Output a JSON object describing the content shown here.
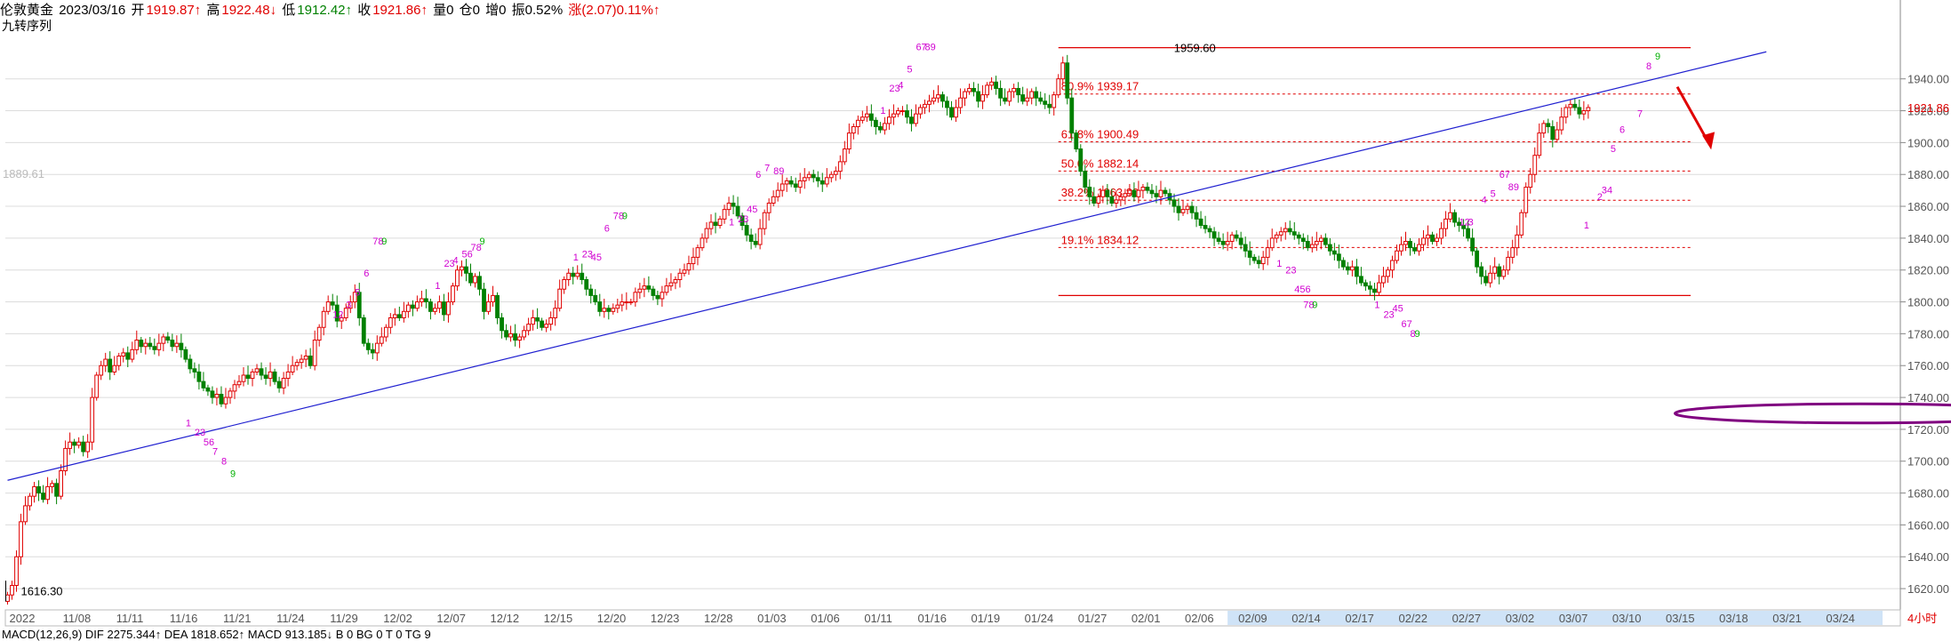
{
  "header": {
    "symbol": "伦敦黄金",
    "date": "2023/03/16",
    "open_label": "开",
    "open": "1919.87↑",
    "high_label": "高",
    "high": "1922.48↓",
    "low_label": "低",
    "low": "1912.42↑",
    "close_label": "收",
    "close": "1921.86↑",
    "vol": "量0",
    "oi": "仓0",
    "inc": "增0",
    "amp": "振0.52%",
    "chg": "涨(2.07)0.11%↑"
  },
  "indicator_name": "九转序列",
  "indicator_bar": "MACD(12,26,9)  DIF 2275.344↑  DEA 1818.652↑  MACD 913.185↓  B 0  BG 0  T 0  TG 9",
  "colors": {
    "up": "#e00000",
    "down": "#008000",
    "trend": "#2020d0",
    "fib": "#e00000",
    "ellipse": "#800080",
    "arrow": "#e00000",
    "td_low": "#d000d0",
    "td_9": "#00b000"
  },
  "chart_data": {
    "type": "candlestick",
    "ylim": [
      1610,
      1975
    ],
    "yticks": [
      1620,
      1640,
      1660,
      1680,
      1700,
      1720,
      1740,
      1760,
      1780,
      1800,
      1820,
      1840,
      1860,
      1880,
      1900,
      1920,
      1940
    ],
    "ytick_labels": [
      "1620.00",
      "1640.00",
      "1660.00",
      "1680.00",
      "1700.00",
      "1720.00",
      "1740.00",
      "1760.00",
      "1780.00",
      "1800.00",
      "1820.00",
      "1840.00",
      "1860.00",
      "1880.00",
      "1900.00",
      "1920.00",
      "1940.00"
    ],
    "x_labels": [
      "2022",
      "11/08",
      "11/11",
      "11/16",
      "11/21",
      "11/24",
      "11/29",
      "12/02",
      "12/07",
      "12/12",
      "12/15",
      "12/20",
      "12/23",
      "12/28",
      "01/03",
      "01/06",
      "01/11",
      "01/16",
      "01/19",
      "01/24",
      "01/27",
      "02/01",
      "02/06",
      "02/09",
      "02/14",
      "02/17",
      "02/22",
      "02/27",
      "03/02",
      "03/07",
      "03/10",
      "03/15",
      "03/18",
      "03/21",
      "03/24"
    ],
    "x_label_slot": [
      0,
      12,
      24,
      36,
      48,
      60,
      72,
      84,
      96,
      108,
      120,
      132,
      144,
      156,
      168,
      180,
      192,
      204,
      216,
      228,
      240,
      252,
      264,
      276,
      288,
      300,
      312,
      324,
      336,
      348,
      360,
      372,
      384,
      396,
      408
    ],
    "timeframe": "4小时",
    "last_price": "1921.86",
    "prev_high_label": "1889.61",
    "low_label": "1616.30",
    "high_label": "1959.60",
    "closes": [
      1616,
      1622,
      1640,
      1662,
      1672,
      1678,
      1684,
      1680,
      1676,
      1684,
      1686,
      1678,
      1694,
      1708,
      1712,
      1710,
      1712,
      1706,
      1712,
      1740,
      1754,
      1760,
      1764,
      1756,
      1760,
      1766,
      1768,
      1764,
      1770,
      1776,
      1772,
      1774,
      1772,
      1770,
      1774,
      1778,
      1776,
      1772,
      1774,
      1770,
      1764,
      1758,
      1756,
      1750,
      1746,
      1744,
      1740,
      1742,
      1736,
      1740,
      1744,
      1748,
      1750,
      1754,
      1752,
      1756,
      1758,
      1754,
      1752,
      1756,
      1750,
      1746,
      1752,
      1756,
      1760,
      1762,
      1764,
      1766,
      1760,
      1776,
      1784,
      1794,
      1800,
      1798,
      1788,
      1790,
      1796,
      1800,
      1806,
      1790,
      1774,
      1770,
      1768,
      1774,
      1778,
      1784,
      1790,
      1792,
      1790,
      1794,
      1798,
      1796,
      1800,
      1802,
      1800,
      1794,
      1796,
      1800,
      1792,
      1800,
      1810,
      1820,
      1822,
      1818,
      1812,
      1816,
      1808,
      1794,
      1800,
      1804,
      1790,
      1782,
      1778,
      1780,
      1776,
      1778,
      1782,
      1786,
      1790,
      1788,
      1784,
      1786,
      1790,
      1796,
      1808,
      1814,
      1818,
      1816,
      1818,
      1814,
      1808,
      1804,
      1800,
      1794,
      1796,
      1794,
      1796,
      1798,
      1800,
      1800,
      1800,
      1806,
      1808,
      1810,
      1808,
      1804,
      1802,
      1806,
      1810,
      1812,
      1814,
      1818,
      1820,
      1824,
      1828,
      1834,
      1840,
      1846,
      1850,
      1848,
      1852,
      1858,
      1862,
      1860,
      1854,
      1848,
      1842,
      1838,
      1836,
      1846,
      1856,
      1862,
      1866,
      1870,
      1874,
      1876,
      1874,
      1872,
      1876,
      1878,
      1880,
      1878,
      1876,
      1874,
      1878,
      1880,
      1882,
      1888,
      1896,
      1906,
      1910,
      1914,
      1916,
      1918,
      1914,
      1910,
      1908,
      1912,
      1916,
      1918,
      1920,
      1920,
      1916,
      1912,
      1918,
      1922,
      1924,
      1926,
      1928,
      1930,
      1926,
      1922,
      1916,
      1922,
      1928,
      1932,
      1934,
      1932,
      1926,
      1930,
      1936,
      1938,
      1934,
      1928,
      1926,
      1932,
      1934,
      1930,
      1926,
      1928,
      1932,
      1928,
      1926,
      1924,
      1922,
      1930,
      1940,
      1950,
      1928,
      1906,
      1896,
      1882,
      1872,
      1866,
      1862,
      1866,
      1870,
      1866,
      1862,
      1864,
      1866,
      1868,
      1870,
      1866,
      1870,
      1872,
      1870,
      1868,
      1866,
      1870,
      1868,
      1864,
      1860,
      1856,
      1858,
      1860,
      1856,
      1852,
      1848,
      1846,
      1844,
      1840,
      1838,
      1836,
      1838,
      1842,
      1840,
      1836,
      1832,
      1828,
      1826,
      1824,
      1828,
      1834,
      1840,
      1842,
      1844,
      1846,
      1844,
      1842,
      1840,
      1838,
      1834,
      1836,
      1838,
      1840,
      1836,
      1832,
      1830,
      1826,
      1822,
      1820,
      1822,
      1816,
      1812,
      1810,
      1808,
      1806,
      1812,
      1816,
      1820,
      1826,
      1832,
      1836,
      1838,
      1834,
      1832,
      1836,
      1840,
      1842,
      1838,
      1840,
      1846,
      1852,
      1856,
      1850,
      1848,
      1846,
      1840,
      1832,
      1822,
      1816,
      1812,
      1818,
      1822,
      1816,
      1820,
      1828,
      1834,
      1842,
      1856,
      1872,
      1880,
      1892,
      1906,
      1912,
      1910,
      1902,
      1908,
      1916,
      1922,
      1924,
      1922,
      1918,
      1920,
      1922
    ],
    "fib_levels": [
      {
        "label": "80.9%  1939.17",
        "value": 1930.5
      },
      {
        "label": "61.8%  1900.49",
        "value": 1900.49
      },
      {
        "label": "50.0%  1882.14",
        "value": 1882.14
      },
      {
        "label": "38.2%  1863.80",
        "value": 1863.8
      },
      {
        "label": "19.1%  1834.12",
        "value": 1834.12
      }
    ],
    "fib_top": 1959.6,
    "fib_bottom": 1804.0,
    "trendline": [
      [
        0,
        1688
      ],
      [
        395,
        1957
      ]
    ],
    "ellipses": [
      {
        "cx": 52,
        "cy": 1730,
        "rx": 26,
        "ry": 6
      },
      {
        "cx": 125,
        "cy": 1781,
        "rx": 35,
        "ry": 10
      },
      {
        "cx": 268,
        "cy": 1864,
        "rx": 26,
        "ry": 8
      },
      {
        "cx": 375,
        "cy": 1933,
        "rx": 25,
        "ry": 9
      }
    ],
    "td_labels": [
      {
        "slot": 40,
        "v": 1722,
        "t": "1"
      },
      {
        "slot": 42,
        "v": 1716,
        "t": "23"
      },
      {
        "slot": 44,
        "v": 1710,
        "t": "56"
      },
      {
        "slot": 46,
        "v": 1704,
        "t": "7"
      },
      {
        "slot": 48,
        "v": 1698,
        "t": "8"
      },
      {
        "slot": 50,
        "v": 1690,
        "t": "9"
      },
      {
        "slot": 73,
        "v": 1790,
        "t": "12"
      },
      {
        "slot": 76,
        "v": 1796,
        "t": "3"
      },
      {
        "slot": 78,
        "v": 1804,
        "t": "5"
      },
      {
        "slot": 80,
        "v": 1816,
        "t": "6"
      },
      {
        "slot": 82,
        "v": 1836,
        "t": "78"
      },
      {
        "slot": 84,
        "v": 1836,
        "t": "9"
      },
      {
        "slot": 96,
        "v": 1808,
        "t": "1"
      },
      {
        "slot": 98,
        "v": 1822,
        "t": "23"
      },
      {
        "slot": 100,
        "v": 1824,
        "t": "4"
      },
      {
        "slot": 102,
        "v": 1828,
        "t": "56"
      },
      {
        "slot": 104,
        "v": 1832,
        "t": "78"
      },
      {
        "slot": 106,
        "v": 1836,
        "t": "9"
      },
      {
        "slot": 127,
        "v": 1826,
        "t": "1"
      },
      {
        "slot": 129,
        "v": 1828,
        "t": "23"
      },
      {
        "slot": 131,
        "v": 1826,
        "t": "45"
      },
      {
        "slot": 134,
        "v": 1844,
        "t": "6"
      },
      {
        "slot": 136,
        "v": 1852,
        "t": "78"
      },
      {
        "slot": 138,
        "v": 1852,
        "t": "9"
      },
      {
        "slot": 162,
        "v": 1848,
        "t": "1"
      },
      {
        "slot": 164,
        "v": 1850,
        "t": "23"
      },
      {
        "slot": 166,
        "v": 1856,
        "t": "45"
      },
      {
        "slot": 168,
        "v": 1878,
        "t": "6"
      },
      {
        "slot": 170,
        "v": 1882,
        "t": "7"
      },
      {
        "slot": 172,
        "v": 1880,
        "t": "89"
      },
      {
        "slot": 196,
        "v": 1918,
        "t": "1"
      },
      {
        "slot": 198,
        "v": 1932,
        "t": "23"
      },
      {
        "slot": 200,
        "v": 1934,
        "t": "4"
      },
      {
        "slot": 202,
        "v": 1944,
        "t": "5"
      },
      {
        "slot": 204,
        "v": 1958,
        "t": "67"
      },
      {
        "slot": 206,
        "v": 1958,
        "t": "89"
      },
      {
        "slot": 285,
        "v": 1822,
        "t": "1"
      },
      {
        "slot": 287,
        "v": 1818,
        "t": "23"
      },
      {
        "slot": 289,
        "v": 1806,
        "t": "456"
      },
      {
        "slot": 291,
        "v": 1796,
        "t": "78"
      },
      {
        "slot": 293,
        "v": 1796,
        "t": "9"
      },
      {
        "slot": 307,
        "v": 1796,
        "t": "1"
      },
      {
        "slot": 309,
        "v": 1790,
        "t": "23"
      },
      {
        "slot": 311,
        "v": 1794,
        "t": "45"
      },
      {
        "slot": 313,
        "v": 1784,
        "t": "67"
      },
      {
        "slot": 315,
        "v": 1778,
        "t": "8"
      },
      {
        "slot": 316,
        "v": 1778,
        "t": "9"
      },
      {
        "slot": 326,
        "v": 1848,
        "t": "12"
      },
      {
        "slot": 328,
        "v": 1848,
        "t": "3"
      },
      {
        "slot": 331,
        "v": 1862,
        "t": "4"
      },
      {
        "slot": 333,
        "v": 1866,
        "t": "5"
      },
      {
        "slot": 335,
        "v": 1878,
        "t": "67"
      },
      {
        "slot": 337,
        "v": 1870,
        "t": "89"
      },
      {
        "slot": 354,
        "v": 1846,
        "t": "1"
      },
      {
        "slot": 357,
        "v": 1864,
        "t": "2"
      },
      {
        "slot": 358,
        "v": 1868,
        "t": "34"
      },
      {
        "slot": 360,
        "v": 1894,
        "t": "5"
      },
      {
        "slot": 362,
        "v": 1906,
        "t": "6"
      },
      {
        "slot": 366,
        "v": 1916,
        "t": "7"
      },
      {
        "slot": 368,
        "v": 1946,
        "t": "8"
      },
      {
        "slot": 370,
        "v": 1952,
        "t": "9"
      }
    ]
  }
}
